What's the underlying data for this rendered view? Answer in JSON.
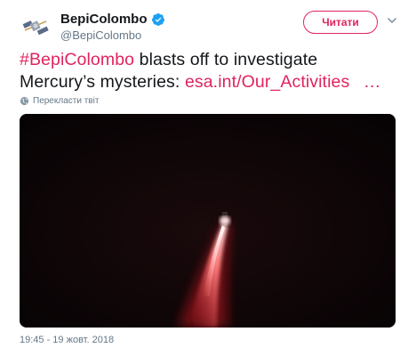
{
  "user": {
    "display_name": "BepiColombo",
    "handle": "@BepiColombo",
    "verified_icon": "verified-badge-icon",
    "avatar_icon": "spacecraft-icon"
  },
  "actions": {
    "follow_label": "Читати",
    "menu_icon": "chevron-down-icon"
  },
  "tweet": {
    "hashtag": "#BepiColombo",
    "text_line1_rest": " blasts off to investigate",
    "text_line2": "Mercury’s mysteries: ",
    "link": "esa.int/Our_Activities",
    "ellipsis": "…",
    "translate_label": "Перекласти твіт"
  },
  "media": {
    "description_icon": "rocket-launch-image"
  },
  "footer": {
    "timestamp": "19:45 - 19 жовт. 2018"
  },
  "colors": {
    "accent": "#e0245e",
    "verified": "#1da1f2",
    "secondary_text": "#657786"
  }
}
